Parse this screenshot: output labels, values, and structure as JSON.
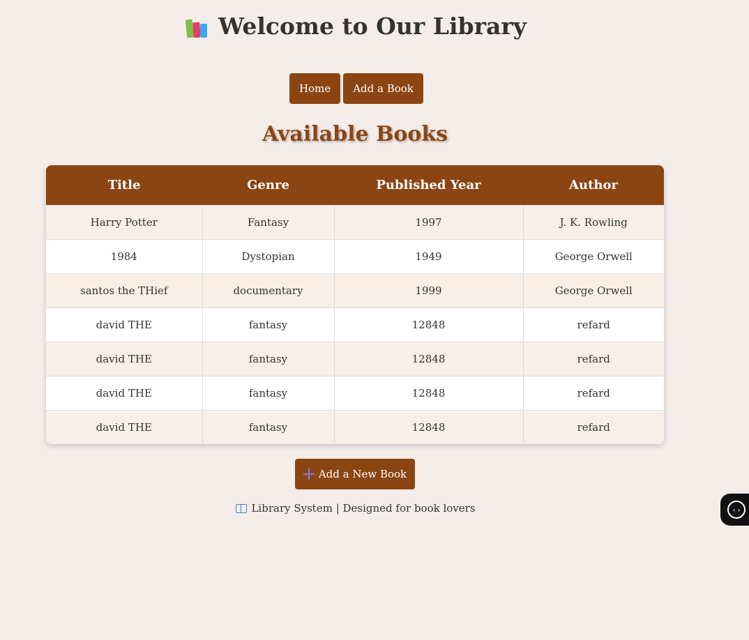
{
  "header": {
    "title": "Welcome to Our Library",
    "icon": "books-icon"
  },
  "nav": {
    "home_label": "Home",
    "add_book_label": "Add a Book"
  },
  "section": {
    "title": "Available Books"
  },
  "table": {
    "columns": [
      "Title",
      "Genre",
      "Published Year",
      "Author"
    ],
    "rows": [
      [
        "Harry Potter",
        "Fantasy",
        "1997",
        "J. K. Rowling"
      ],
      [
        "1984",
        "Dystopian",
        "1949",
        "George Orwell"
      ],
      [
        "santos the THief",
        "documentary",
        "1999",
        "George Orwell"
      ],
      [
        "david THE",
        "fantasy",
        "12848",
        "refard"
      ],
      [
        "david THE",
        "fantasy",
        "12848",
        "refard"
      ],
      [
        "david THE",
        "fantasy",
        "12848",
        "refard"
      ],
      [
        "david THE",
        "fantasy",
        "12848",
        "refard"
      ]
    ]
  },
  "actions": {
    "add_new_label": "Add a New Book",
    "add_new_icon": "plus-icon"
  },
  "footer": {
    "text": "Library System | Designed for book lovers",
    "icon": "open-book-icon"
  },
  "widget": {
    "icon": "search-code-icon",
    "glyph": "‹›"
  },
  "colors": {
    "background": "#f5ede9",
    "accent": "#8b4513",
    "row_alt": "#f9efe7",
    "text": "#333333"
  }
}
